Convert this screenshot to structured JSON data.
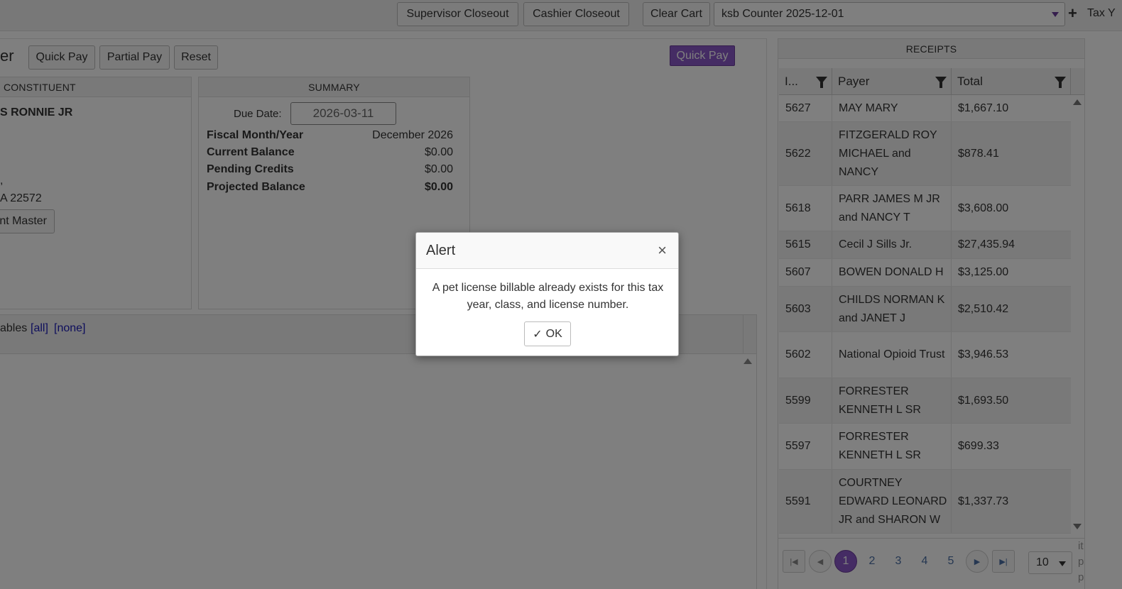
{
  "topbar": {
    "supervisor_closeout": "Supervisor Closeout",
    "cashier_closeout": "Cashier Closeout",
    "clear_cart": "Clear Cart",
    "batch_select": "ksb Counter 2025-12-01",
    "plus_icon": "+",
    "tax_label": "Tax Y"
  },
  "page": {
    "title_fragment": "er",
    "quick_pay": "Quick Pay",
    "partial_pay": "Partial Pay",
    "reset": "Reset",
    "quick_pay_primary": "Quick Pay"
  },
  "constituent": {
    "header": "CONSTITUENT",
    "name": "S RONNIE JR",
    "line_dot": ",",
    "address": "A 22572",
    "master_button": "nt Master"
  },
  "summary": {
    "header": "SUMMARY",
    "due_date_label": "Due Date:",
    "due_date_value": "2026-03-11",
    "rows": [
      {
        "label": "Fiscal Month/Year",
        "value": "December 2026",
        "bold": false
      },
      {
        "label": "Current Balance",
        "value": "$0.00",
        "bold": false
      },
      {
        "label": "Pending Credits",
        "value": "$0.00",
        "bold": false
      },
      {
        "label": "Projected Balance",
        "value": "$0.00",
        "bold": true
      }
    ]
  },
  "billables": {
    "label": "ables",
    "all_link": "[all]",
    "none_link": "[none]"
  },
  "receipts": {
    "header": "RECEIPTS",
    "columns": [
      "I...",
      "Payer",
      "Total"
    ],
    "rows": [
      {
        "id": "5627",
        "payer": "MAY MARY",
        "total": "$1,667.10"
      },
      {
        "id": "5622",
        "payer": "FITZGERALD ROY MICHAEL and NANCY",
        "total": "$878.41"
      },
      {
        "id": "5618",
        "payer": "PARR JAMES M JR and NANCY T",
        "total": "$3,608.00"
      },
      {
        "id": "5615",
        "payer": "Cecil J Sills Jr.",
        "total": "$27,435.94"
      },
      {
        "id": "5607",
        "payer": "BOWEN DONALD H",
        "total": "$3,125.00"
      },
      {
        "id": "5603",
        "payer": "CHILDS NORMAN K and JANET J",
        "total": "$2,510.42"
      },
      {
        "id": "5602",
        "payer": "National Opioid Trust",
        "total": "$3,946.53"
      },
      {
        "id": "5599",
        "payer": "FORRESTER KENNETH L SR",
        "total": "$1,693.50"
      },
      {
        "id": "5597",
        "payer": "FORRESTER KENNETH L SR",
        "total": "$699.33"
      },
      {
        "id": "5591",
        "payer": "COURTNEY EDWARD LEONARD JR and SHARON W",
        "total": "$1,337.73"
      }
    ],
    "pager": {
      "pages": [
        "1",
        "2",
        "3",
        "4",
        "5"
      ],
      "current": "1",
      "page_size": "10",
      "side_text": [
        "it",
        "p",
        "p"
      ]
    }
  },
  "alert": {
    "title": "Alert",
    "close": "×",
    "message": "A pet license billable already exists for this tax year, class, and license number.",
    "ok_label": "OK",
    "ok_icon": "✓"
  },
  "colors": {
    "accent": "#8a58c8",
    "link": "#1a1ab8",
    "overlay": "rgba(0,0,0,0.5)"
  }
}
